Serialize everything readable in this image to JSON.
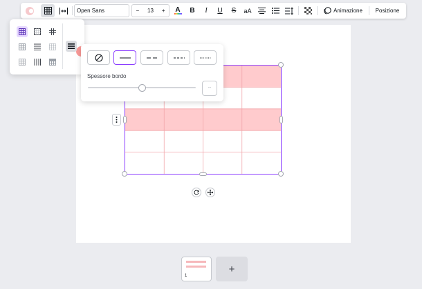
{
  "colors": {
    "accent": "#8b3dff",
    "cell_fill": "#ffcbcd",
    "grid_line": "#f2a6aa",
    "swatch": "#f99a98"
  },
  "toolbar": {
    "font_family": "Open Sans",
    "font_size": {
      "decrease": "−",
      "value": "13",
      "increase": "+"
    },
    "text_color_glyph": "A",
    "bold_glyph": "B",
    "italic_glyph": "I",
    "underline_glyph": "U",
    "strike_glyph": "S",
    "case_glyph": "aA",
    "animation_label": "Animazione",
    "position_label": "Posizione",
    "icons": [
      "color-swatch-icon",
      "table-icon",
      "spacing-icon",
      "text-color-icon",
      "align-center-icon",
      "list-icon",
      "line-spacing-icon",
      "transparency-icon",
      "animation-icon"
    ]
  },
  "style_panel": {
    "selected": "grid-all",
    "cell_color": "#f99a98"
  },
  "border_panel": {
    "label": "Spessore bordo",
    "value": "--",
    "thickness_fraction": 0.5,
    "styles": [
      "none",
      "solid",
      "dashed",
      "short-dashed",
      "dotted"
    ],
    "selected_style": "solid"
  },
  "table": {
    "rows": 5,
    "cols": 4,
    "filled_rows": [
      0,
      2
    ]
  },
  "pages": {
    "current_number": "1",
    "add_glyph": "+"
  }
}
